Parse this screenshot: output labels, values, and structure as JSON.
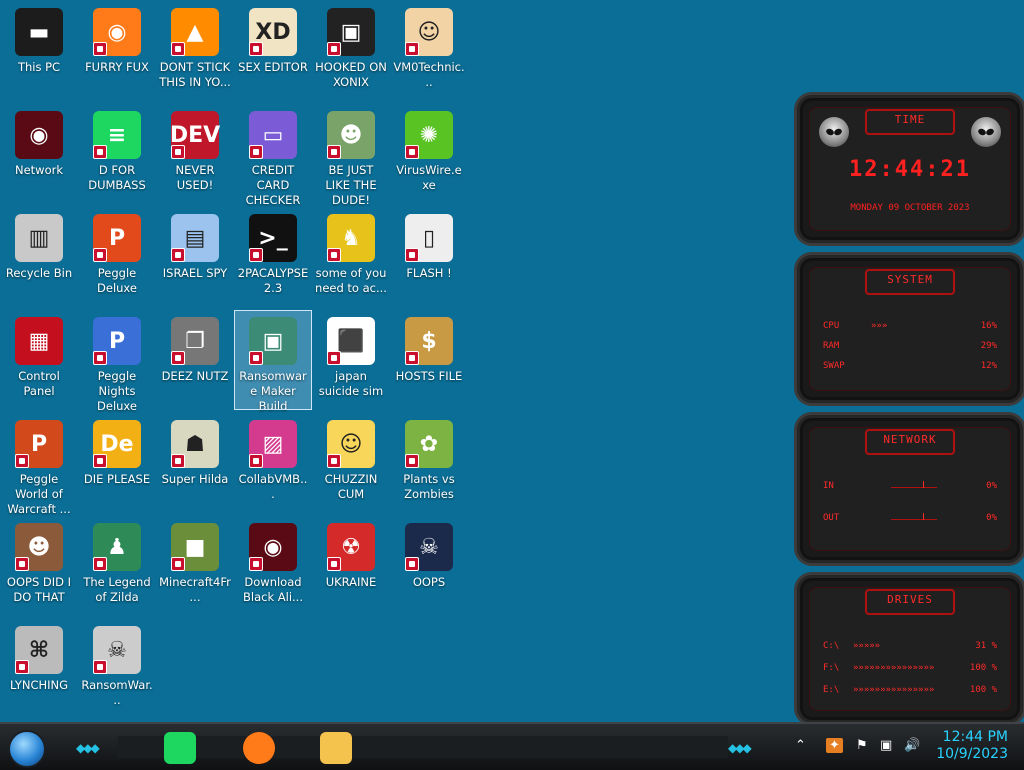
{
  "desktop": {
    "icons": [
      {
        "label": "This PC",
        "icon": "computer-icon",
        "color": "#1c1c1c",
        "glyph": "▬"
      },
      {
        "label": "FURRY FUX",
        "icon": "firefox-icon",
        "color": "#ff7a18",
        "glyph": "◉"
      },
      {
        "label": "DONT STICK THIS IN YO...",
        "icon": "vlc-cone-icon",
        "color": "#ff8c00",
        "glyph": "▲"
      },
      {
        "label": "SEX EDITOR",
        "icon": "hxd-icon",
        "color": "#f1e4c4",
        "glyph": "XD"
      },
      {
        "label": "HOOKED ON XONIX",
        "icon": "xonix-icon",
        "color": "#222222",
        "glyph": "▣"
      },
      {
        "label": "VM0Technic...",
        "icon": "technician-icon",
        "color": "#f2d3a5",
        "glyph": "☺"
      },
      {
        "label": "Network",
        "icon": "network-orb-icon",
        "color": "#5a0a14",
        "glyph": "◉"
      },
      {
        "label": "D FOR DUMBASS",
        "icon": "chat-icon",
        "color": "#1ed760",
        "glyph": "≡"
      },
      {
        "label": "NEVER USED!",
        "icon": "dev-cpp-icon",
        "color": "#c0182a",
        "glyph": "DEV"
      },
      {
        "label": "CREDIT CARD CHECKER",
        "icon": "credit-card-icon",
        "color": "#7b5cd6",
        "glyph": "▭"
      },
      {
        "label": "BE JUST LIKE THE DUDE!",
        "icon": "elf-icon",
        "color": "#7aa36a",
        "glyph": "☻"
      },
      {
        "label": "VirusWire.exe",
        "icon": "lime-icon",
        "color": "#58c322",
        "glyph": "✺"
      },
      {
        "label": "Recycle Bin",
        "icon": "recycle-bin-icon",
        "color": "#c9c9c9",
        "glyph": "▥"
      },
      {
        "label": "Peggle Deluxe",
        "icon": "peggle-icon",
        "color": "#e24a1c",
        "glyph": "P"
      },
      {
        "label": "ISRAEL SPY",
        "icon": "spy-network-icon",
        "color": "#9bc3ee",
        "glyph": "▤"
      },
      {
        "label": "2PACALYPSE 2.3",
        "icon": "terminal-icon",
        "color": "#111111",
        "glyph": ">_"
      },
      {
        "label": "some of you need to ac...",
        "icon": "dog-icon",
        "color": "#e7c21a",
        "glyph": "♞"
      },
      {
        "label": "FLASH !",
        "icon": "cards-icon",
        "color": "#eeeeee",
        "glyph": "▯"
      },
      {
        "label": "Control Panel",
        "icon": "control-panel-icon",
        "color": "#c4101e",
        "glyph": "▦"
      },
      {
        "label": "Peggle Nights Deluxe",
        "icon": "peggle-nights-icon",
        "color": "#3b6fd8",
        "glyph": "P"
      },
      {
        "label": "DEEZ NUTZ",
        "icon": "stacked-windows-icon",
        "color": "#777777",
        "glyph": "❐"
      },
      {
        "label": "Ransomware Maker Build",
        "icon": "ransomware-builder-icon",
        "color": "#3c8b77",
        "glyph": "▣"
      },
      {
        "label": "japan suicide sim",
        "icon": "japan-sim-icon",
        "color": "#ffffff",
        "glyph": "⬛"
      },
      {
        "label": "HOSTS FILE",
        "icon": "money-bag-icon",
        "color": "#c89a44",
        "glyph": "$"
      },
      {
        "label": "Peggle World of Warcraft ...",
        "icon": "peggle-wow-icon",
        "color": "#d24a1c",
        "glyph": "P"
      },
      {
        "label": "DIE PLEASE",
        "icon": "de-icon",
        "color": "#f3b014",
        "glyph": "De"
      },
      {
        "label": "Super Hilda",
        "icon": "hilda-icon",
        "color": "#d8d8c0",
        "glyph": "☗"
      },
      {
        "label": "CollabVMB...",
        "icon": "collabvm-icon",
        "color": "#d43a8e",
        "glyph": "▨"
      },
      {
        "label": "CHUZZIN CUM",
        "icon": "chuzzle-icon",
        "color": "#f7d65a",
        "glyph": "☺"
      },
      {
        "label": "Plants vs Zombies",
        "icon": "pvz-icon",
        "color": "#7cb342",
        "glyph": "✿"
      },
      {
        "label": "OOPS DID I DO THAT",
        "icon": "portrait-icon",
        "color": "#8a5a3a",
        "glyph": "☻"
      },
      {
        "label": "The Legend of Zilda",
        "icon": "zelda-icon",
        "color": "#2e8b57",
        "glyph": "♟"
      },
      {
        "label": "Minecraft4Fr...",
        "icon": "minecraft-icon",
        "color": "#6b8e3a",
        "glyph": "■"
      },
      {
        "label": "Download Black Ali...",
        "icon": "alien-orb-icon",
        "color": "#5a0a14",
        "glyph": "◉"
      },
      {
        "label": "UKRAINE",
        "icon": "radiation-icon",
        "color": "#d42a2a",
        "glyph": "☢"
      },
      {
        "label": "OOPS",
        "icon": "skull-book-icon",
        "color": "#1b2a4a",
        "glyph": "☠"
      },
      {
        "label": "LYNCHING",
        "icon": "noose-icon",
        "color": "#bbbbbb",
        "glyph": "⌘"
      },
      {
        "label": "RansomWar...",
        "icon": "skull-ring-icon",
        "color": "#cccccc",
        "glyph": "☠"
      }
    ]
  },
  "gadget": {
    "time_title": "TIME",
    "time": "12:44:21",
    "date": "MONDAY 09 OCTOBER 2023",
    "system_title": "SYSTEM",
    "system_rows": [
      {
        "k": "CPU",
        "m": "»»»",
        "v": "16%"
      },
      {
        "k": "RAM",
        "m": "",
        "v": "29%"
      },
      {
        "k": "SWAP",
        "m": "",
        "v": "12%"
      }
    ],
    "network_title": "NETWORK",
    "network_rows": [
      {
        "k": "IN",
        "v": "0%"
      },
      {
        "k": "OUT",
        "v": "0%"
      }
    ],
    "drives_title": "DRIVES",
    "drive_rows": [
      {
        "k": "C:\\",
        "m": "»»»»»",
        "v": "31 %"
      },
      {
        "k": "F:\\",
        "m": "»»»»»»»»»»»»»»»",
        "v": "100 %"
      },
      {
        "k": "E:\\",
        "m": "»»»»»»»»»»»»»»»",
        "v": "100 %"
      }
    ]
  },
  "taskbar": {
    "apps": [
      {
        "icon": "chat-app-icon",
        "color": "#1ed760"
      },
      {
        "icon": "firefox-icon",
        "color": "#ff7a18"
      },
      {
        "icon": "file-explorer-icon",
        "color": "#f3c34d"
      }
    ],
    "tray": {
      "show_hidden": "⌃",
      "flag": "⚑",
      "network": "▣",
      "volume": "🔊"
    },
    "clock_time": "12:44 PM",
    "clock_date": "10/9/2023"
  }
}
